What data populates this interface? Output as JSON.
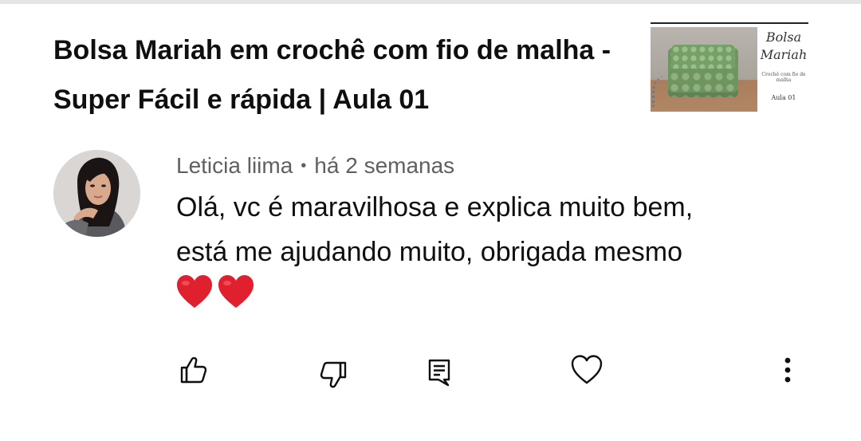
{
  "video": {
    "title": "Bolsa Mariah em crochê com fio de malha - Super Fácil e rápida | Aula 01",
    "thumbnail": {
      "title_line1": "Bolsa",
      "title_line2": "Mariah",
      "subtitle": "Crochê com fio de malha",
      "lesson": "Aula 01"
    }
  },
  "comment": {
    "author": "Leticia liima",
    "separator": "•",
    "time": "há 2 semanas",
    "text": "Olá, vc é maravilhosa e explica muito bem,\nestá me ajudando muito, obrigada mesmo",
    "emoji": "❤️❤️"
  },
  "actions": {
    "like": "thumbs-up-icon",
    "dislike": "thumbs-down-icon",
    "reply": "reply-icon",
    "heart": "heart-icon",
    "more": "more-vert-icon"
  },
  "colors": {
    "text": "#0f0f0f",
    "meta": "#606060",
    "heart": "#e0202e"
  }
}
